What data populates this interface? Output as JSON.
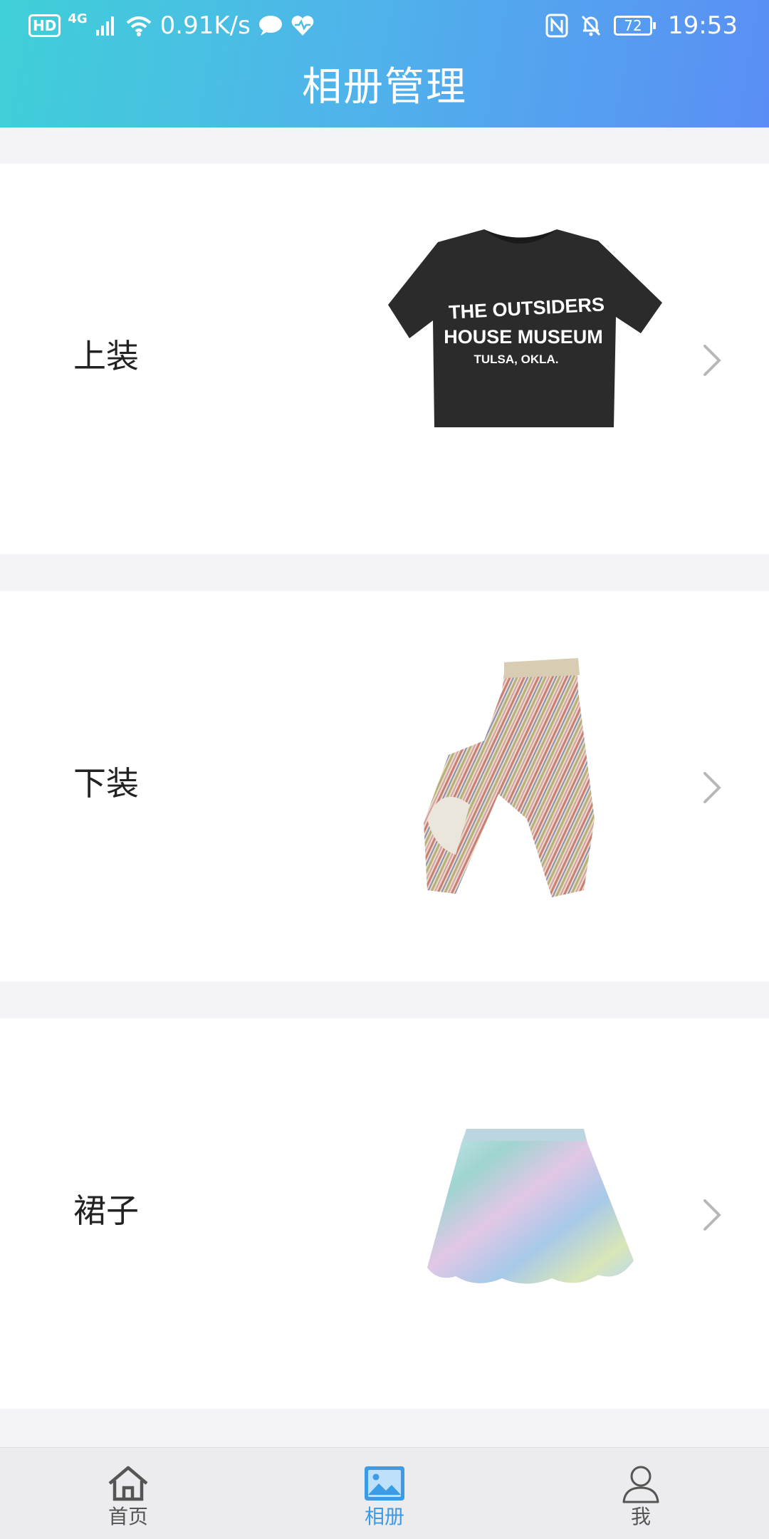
{
  "status_bar": {
    "hd": "HD",
    "network": "4G",
    "speed": "0.91K/s",
    "battery": "72",
    "time": "19:53"
  },
  "header": {
    "title": "相册管理"
  },
  "albums": [
    {
      "label": "上装",
      "thumb_icon": "tshirt-photo",
      "shirt_line1": "THE OUTSIDERS",
      "shirt_line2": "HOUSE MUSEUM",
      "shirt_line3": "TULSA, OKLA."
    },
    {
      "label": "下装",
      "thumb_icon": "striped-pants-photo"
    },
    {
      "label": "裙子",
      "thumb_icon": "holographic-skirt-photo"
    }
  ],
  "tabs": [
    {
      "label": "首页",
      "icon": "home-icon",
      "active": false
    },
    {
      "label": "相册",
      "icon": "album-icon",
      "active": true
    },
    {
      "label": "我",
      "icon": "user-icon",
      "active": false
    }
  ],
  "colors": {
    "header_start": "#3fd0d8",
    "header_end": "#5a8ef5",
    "active_tab": "#3a9be6"
  }
}
